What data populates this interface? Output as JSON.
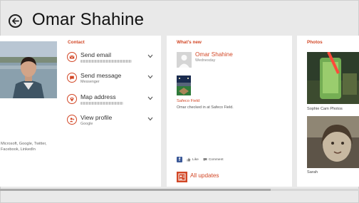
{
  "header": {
    "title": "Omar Shahine"
  },
  "contact": {
    "section_title": "Contact",
    "profile_caption": "Microsoft, Google, Twitter, Facebook, LinkedIn",
    "items": [
      {
        "label": "Send email",
        "sub": "",
        "icon": "mail-icon"
      },
      {
        "label": "Send message",
        "sub": "Messenger",
        "icon": "message-icon"
      },
      {
        "label": "Map address",
        "sub": "",
        "icon": "map-pin-icon"
      },
      {
        "label": "View profile",
        "sub": "Google",
        "icon": "person-add-icon"
      }
    ]
  },
  "whats_new": {
    "section_title": "What's new",
    "author": "Omar Shahine",
    "day": "Wednesday",
    "place": "Safeco Field",
    "checkin_text": "Omar checked in at Safeco Field.",
    "like_label": "Like",
    "comment_label": "Comment"
  },
  "updates": {
    "label": "All updates"
  },
  "photos": {
    "section_title": "Photos",
    "albums": [
      {
        "caption": "Sophie Cam Photos"
      },
      {
        "caption": "Sarah"
      }
    ]
  },
  "colors": {
    "accent": "#d24726",
    "background": "#e9e9e9",
    "panel": "#ffffff",
    "facebook": "#3b5998"
  }
}
